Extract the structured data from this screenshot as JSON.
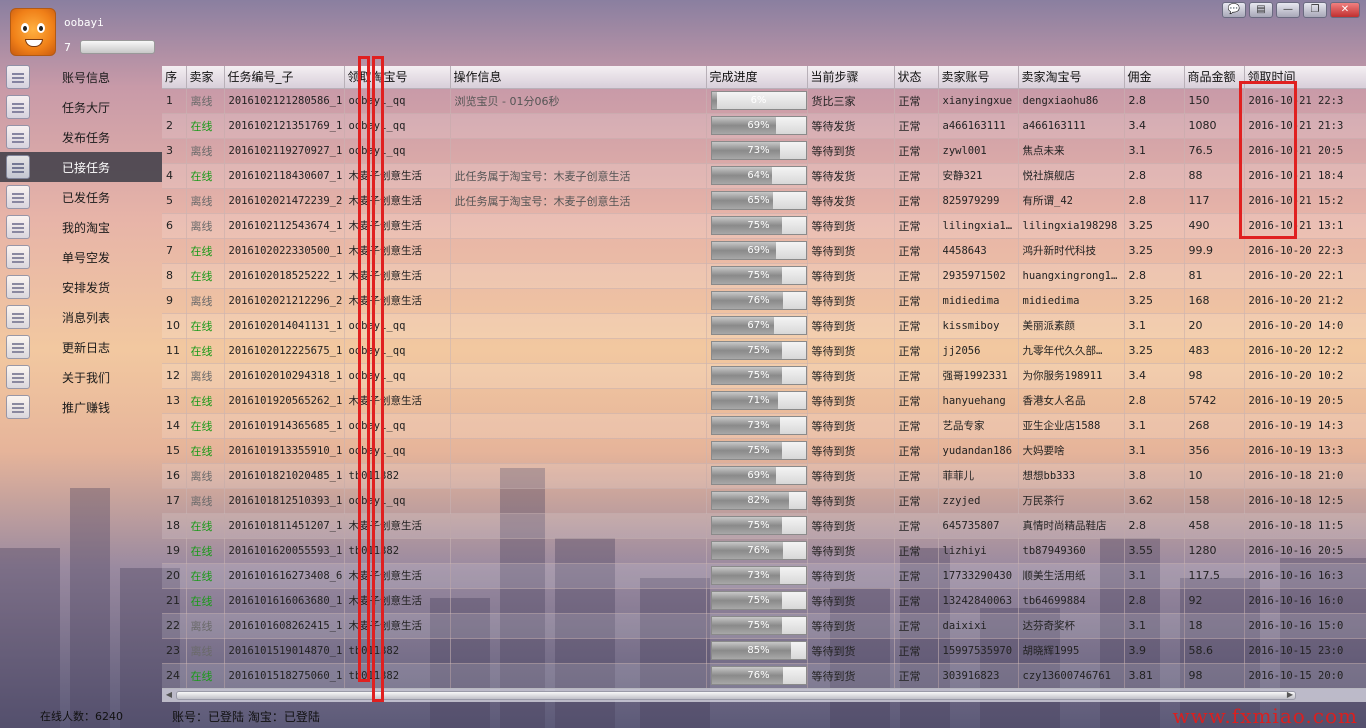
{
  "header": {
    "username": "oobayi",
    "level": "7"
  },
  "window_buttons": [
    {
      "name": "chat-icon",
      "glyph": "💬"
    },
    {
      "name": "skin-icon",
      "glyph": "▤"
    },
    {
      "name": "minimize-icon",
      "glyph": "—"
    },
    {
      "name": "maximize-icon",
      "glyph": "❐"
    },
    {
      "name": "close-icon",
      "glyph": "✕"
    }
  ],
  "sidebar": {
    "active": "已接任务",
    "items": [
      {
        "label": "账号信息",
        "icon": "account-icon"
      },
      {
        "label": "任务大厅",
        "icon": "task-hall-icon"
      },
      {
        "label": "发布任务",
        "icon": "calendar-icon"
      },
      {
        "label": "已接任务",
        "icon": "download-icon"
      },
      {
        "label": "已发任务",
        "icon": "upload-icon"
      },
      {
        "label": "我的淘宝",
        "icon": "taobao-icon"
      },
      {
        "label": "单号空发",
        "icon": "truck-icon"
      },
      {
        "label": "安排发货",
        "icon": "shipping-icon"
      },
      {
        "label": "消息列表",
        "icon": "message-icon"
      },
      {
        "label": "更新日志",
        "icon": "log-icon"
      },
      {
        "label": "关于我们",
        "icon": "about-icon"
      },
      {
        "label": "推广赚钱",
        "icon": "promote-icon"
      }
    ]
  },
  "table": {
    "columns": [
      "序",
      "卖家",
      "任务编号_子",
      "领取淘宝号",
      "操作信息",
      "完成进度",
      "当前步骤",
      "状态",
      "卖家账号",
      "卖家淘宝号",
      "佣金",
      "商品金额",
      "领取时间"
    ],
    "rows": [
      [
        "1",
        "离线",
        "2016102121280586_1",
        "oobayi_qq",
        "浏览宝贝 - 01分06秒",
        "6",
        "货比三家",
        "正常",
        "xianyingxue",
        "dengxiaohu86",
        "2.8",
        "150",
        "2016-10-21 22:3"
      ],
      [
        "2",
        "在线",
        "2016102121351769_1",
        "oobayi_qq",
        "",
        "69",
        "等待发货",
        "正常",
        "a466163111",
        "a466163111",
        "3.4",
        "1080",
        "2016-10-21 21:3"
      ],
      [
        "3",
        "离线",
        "2016102119270927_1",
        "oobayi_qq",
        "",
        "73",
        "等待到货",
        "正常",
        "zywl001",
        "焦点未来",
        "3.1",
        "76.5",
        "2016-10-21 20:5"
      ],
      [
        "4",
        "在线",
        "2016102118430607_1",
        "木麦子创意生活",
        "此任务属于淘宝号：木麦子创意生活",
        "64",
        "等待发货",
        "正常",
        "安静321",
        "悦社旗舰店",
        "2.8",
        "88",
        "2016-10-21 18:4"
      ],
      [
        "5",
        "离线",
        "2016102021472239_2",
        "木麦子创意生活",
        "此任务属于淘宝号：木麦子创意生活",
        "65",
        "等待发货",
        "正常",
        "825979299",
        "有所谓_42",
        "2.8",
        "117",
        "2016-10-21 15:2"
      ],
      [
        "6",
        "离线",
        "2016102112543674_1",
        "木麦子创意生活",
        "",
        "75",
        "等待到货",
        "正常",
        "lilingxia1…",
        "lilingxia198298",
        "3.25",
        "490",
        "2016-10-21 13:1"
      ],
      [
        "7",
        "在线",
        "2016102022330500_1",
        "木麦子创意生活",
        "",
        "69",
        "等待到货",
        "正常",
        "4458643",
        "鸿升新时代科技",
        "3.25",
        "99.9",
        "2016-10-20 22:3"
      ],
      [
        "8",
        "在线",
        "2016102018525222_1",
        "木麦子创意生活",
        "",
        "75",
        "等待到货",
        "正常",
        "2935971502",
        "huangxingrong1…",
        "2.8",
        "81",
        "2016-10-20 22:1"
      ],
      [
        "9",
        "离线",
        "2016102021212296_2",
        "木麦子创意生活",
        "",
        "76",
        "等待到货",
        "正常",
        "midiedima",
        "midiedima",
        "3.25",
        "168",
        "2016-10-20 21:2"
      ],
      [
        "10",
        "在线",
        "2016102014041131_1",
        "oobayi_qq",
        "",
        "67",
        "等待到货",
        "正常",
        "kissmiboy",
        "美丽派素颜",
        "3.1",
        "20",
        "2016-10-20 14:0"
      ],
      [
        "11",
        "在线",
        "2016102012225675_1",
        "oobayi_qq",
        "",
        "75",
        "等待到货",
        "正常",
        "jj2056",
        "九零年代久久部…",
        "3.25",
        "483",
        "2016-10-20 12:2"
      ],
      [
        "12",
        "离线",
        "2016102010294318_1",
        "oobayi_qq",
        "",
        "75",
        "等待到货",
        "正常",
        "强哥1992331",
        "为你服务198911",
        "3.4",
        "98",
        "2016-10-20 10:2"
      ],
      [
        "13",
        "在线",
        "2016101920565262_1",
        "木麦子创意生活",
        "",
        "71",
        "等待到货",
        "正常",
        "hanyuehang",
        "香港女人名品",
        "2.8",
        "5742",
        "2016-10-19 20:5"
      ],
      [
        "14",
        "在线",
        "2016101914365685_1",
        "oobayi_qq",
        "",
        "73",
        "等待到货",
        "正常",
        "艺品专家",
        "亚生企业店1588",
        "3.1",
        "268",
        "2016-10-19 14:3"
      ],
      [
        "15",
        "在线",
        "2016101913355910_1",
        "oobayi_qq",
        "",
        "75",
        "等待到货",
        "正常",
        "yudandan186",
        "大妈要啥",
        "3.1",
        "356",
        "2016-10-19 13:3"
      ],
      [
        "16",
        "离线",
        "2016101821020485_1",
        "tb011382",
        "",
        "69",
        "等待到货",
        "正常",
        "菲菲儿",
        "想想bb333",
        "3.8",
        "10",
        "2016-10-18 21:0"
      ],
      [
        "17",
        "离线",
        "2016101812510393_1",
        "oobayi_qq",
        "",
        "82",
        "等待到货",
        "正常",
        "zzyjed",
        "万民茶行",
        "3.62",
        "158",
        "2016-10-18 12:5"
      ],
      [
        "18",
        "在线",
        "2016101811451207_1",
        "木麦子创意生活",
        "",
        "75",
        "等待到货",
        "正常",
        "645735807",
        "真情时尚精品鞋店",
        "2.8",
        "458",
        "2016-10-18 11:5"
      ],
      [
        "19",
        "在线",
        "2016101620055593_1",
        "tb011382",
        "",
        "76",
        "等待到货",
        "正常",
        "lizhiyi",
        "tb87949360",
        "3.55",
        "1280",
        "2016-10-16 20:5"
      ],
      [
        "20",
        "在线",
        "2016101616273408_6",
        "木麦子创意生活",
        "",
        "73",
        "等待到货",
        "正常",
        "17733290430",
        "顺美生活用纸",
        "3.1",
        "117.5",
        "2016-10-16 16:3"
      ],
      [
        "21",
        "在线",
        "2016101616063680_1",
        "木麦子创意生活",
        "",
        "75",
        "等待到货",
        "正常",
        "13242840063",
        "tb64699884",
        "2.8",
        "92",
        "2016-10-16 16:0"
      ],
      [
        "22",
        "离线",
        "2016101608262415_1",
        "木麦子创意生活",
        "",
        "75",
        "等待到货",
        "正常",
        "daixixi",
        "达芬奇奖杯",
        "3.1",
        "18",
        "2016-10-16 15:0"
      ],
      [
        "23",
        "离线",
        "2016101519014870_1",
        "tb011382",
        "",
        "85",
        "等待到货",
        "正常",
        "15997535970",
        "胡晓辉1995",
        "3.9",
        "58.6",
        "2016-10-15 23:0"
      ],
      [
        "24",
        "在线",
        "2016101518275060_1",
        "tb011382",
        "",
        "76",
        "等待到货",
        "正常",
        "303916823",
        "czy13600746761",
        "3.81",
        "98",
        "2016-10-15 20:0"
      ]
    ]
  },
  "status": {
    "online_count": "在线人数：6240",
    "login_info": "账号：已登陆  淘宝：已登陆",
    "watermark": "www.fxmiao.com"
  },
  "colors": {
    "online": "#1a9a1a",
    "offline": "#6a6a6a",
    "highlight": "#e02020",
    "active_nav": "#3c3c46"
  }
}
